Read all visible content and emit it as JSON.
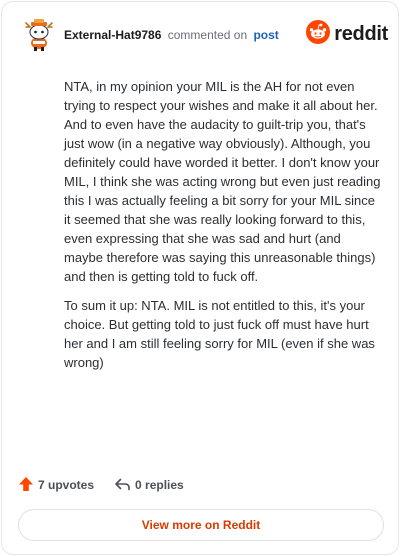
{
  "header": {
    "username": "External-Hat9786",
    "action": "commented on",
    "post_link": "post",
    "brand": "reddit"
  },
  "comment": {
    "paragraphs": [
      "NTA, in my opinion your MIL is the AH for not even trying to respect your wishes and make it all about her. And to even have the audacity to guilt-trip you, that's just wow (in a negative way obviously). Although, you definitely could have worded it better. I don't know your MIL, I think she was acting wrong but even just reading this I was actually feeling a bit sorry for your MIL since it seemed that she was really looking forward to this, even expressing that she was sad and hurt (and maybe therefore was saying this unreasonable things) and then is getting told to fuck off.",
      "To sum it up: NTA. MIL is not entitled to this, it's your choice. But getting told to just fuck off must have hurt her and I am still feeling sorry for MIL (even if she was wrong)"
    ]
  },
  "actions": {
    "upvotes": "7 upvotes",
    "replies": "0 replies"
  },
  "footer": {
    "view_more": "View more on Reddit"
  },
  "colors": {
    "reddit_orange": "#ff4500",
    "link_blue": "#1c62b9",
    "cta_text": "#d93a00"
  }
}
